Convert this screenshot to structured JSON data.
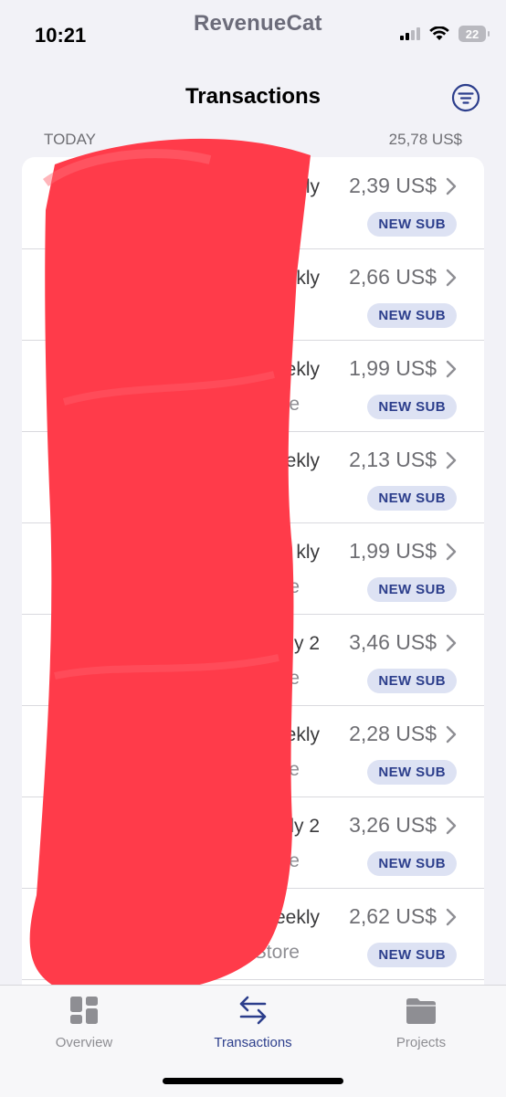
{
  "status_bar": {
    "time": "10:21",
    "app_brand": "RevenueCat",
    "battery_level": "22"
  },
  "header": {
    "title": "Transactions",
    "filter_icon": "filter-circle-icon"
  },
  "section": {
    "label": "TODAY",
    "total": "25,78 US$"
  },
  "transactions": [
    {
      "name": "er Weekly",
      "store": "",
      "amount": "2,39 US$",
      "badge": "NEW SUB"
    },
    {
      "name": "Weekly",
      "store": "",
      "amount": "2,66 US$",
      "badge": "NEW SUB"
    },
    {
      "name": "Weekly",
      "store": "ore",
      "amount": "1,99 US$",
      "badge": "NEW SUB"
    },
    {
      "name": "ekly",
      "store": "",
      "amount": "2,13 US$",
      "badge": "NEW SUB"
    },
    {
      "name": "kly",
      "store": "e",
      "amount": "1,99 US$",
      "badge": "NEW SUB"
    },
    {
      "name": "ly 2",
      "store": "ore",
      "amount": "3,46 US$",
      "badge": "NEW SUB"
    },
    {
      "name": "Weekly",
      "store": "Store",
      "amount": "2,28 US$",
      "badge": "NEW SUB"
    },
    {
      "name": "Weekly 2",
      "store": "Store",
      "amount": "3,26 US$",
      "badge": "NEW SUB"
    },
    {
      "name": "Weekly",
      "store": "App Store",
      "amount": "2,62 US$",
      "badge": "NEW SUB"
    }
  ],
  "tab_bar": {
    "tabs": [
      {
        "label": "Overview",
        "icon": "dashboard-icon",
        "active": false
      },
      {
        "label": "Transactions",
        "icon": "arrows-swap-icon",
        "active": true
      },
      {
        "label": "Projects",
        "icon": "folder-icon",
        "active": false
      }
    ]
  },
  "colors": {
    "accent": "#2c3e8c",
    "badge_bg": "#dde2f3",
    "background": "#f2f2f7",
    "redaction": "#ff3b4a"
  }
}
